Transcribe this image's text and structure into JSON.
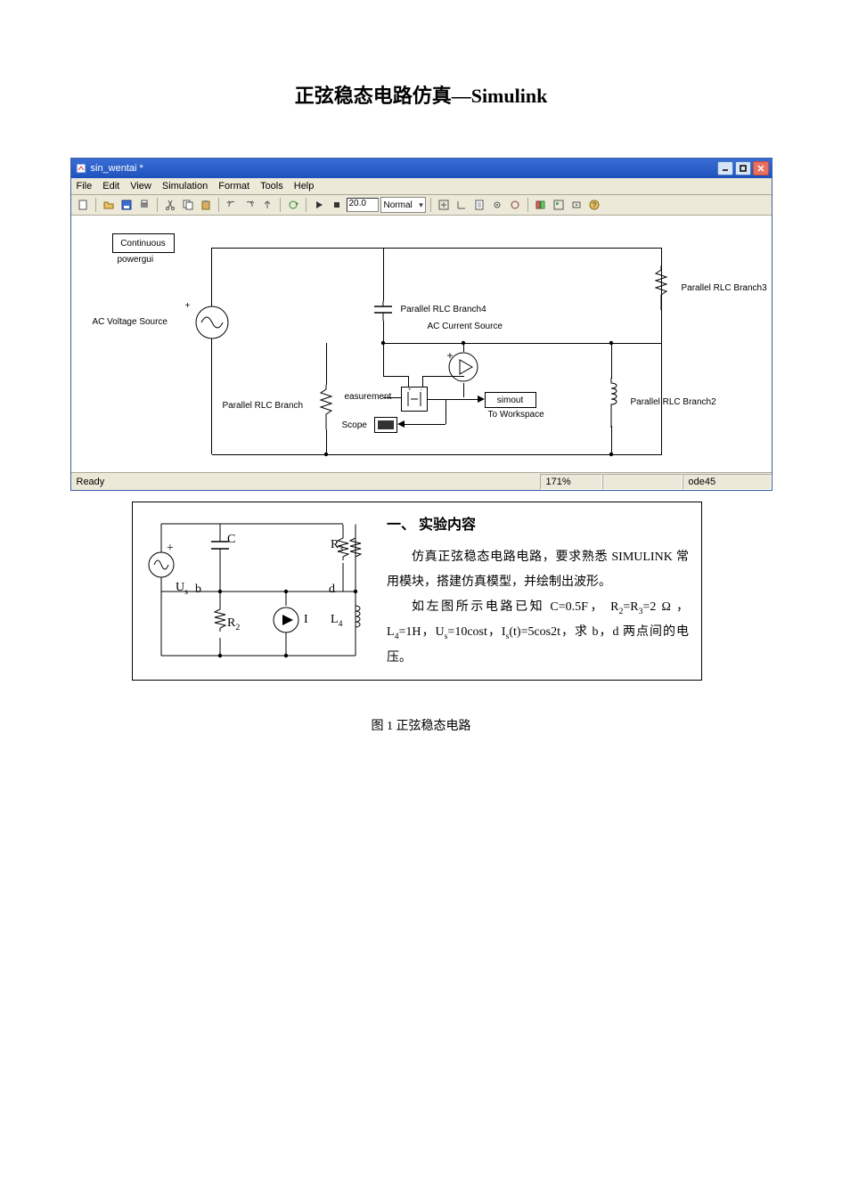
{
  "doc_title_cn": "正弦稳态电路仿真—",
  "doc_title_latin": "Simulink",
  "window": {
    "file_title": "sin_wentai *",
    "menu": [
      "File",
      "Edit",
      "View",
      "Simulation",
      "Format",
      "Tools",
      "Help"
    ],
    "toolbar": {
      "stop_time": "20.0",
      "mode": "Normal"
    },
    "status": {
      "ready": "Ready",
      "zoom": "171%",
      "solver": "ode45"
    }
  },
  "blocks": {
    "powergui_box": "Continuous",
    "powergui_label": "powergui",
    "ac_voltage": "AC Voltage Source",
    "branch": "Parallel RLC Branch",
    "branch2": "Parallel RLC Branch2",
    "branch3": "Parallel RLC Branch3",
    "branch4": "Parallel RLC Branch4",
    "ac_current": "AC Current Source",
    "measurement": "easurement",
    "scope": "Scope",
    "simout_box": "simout",
    "to_workspace": "To Workspace"
  },
  "schematic": {
    "Us": "Us",
    "plus": "+",
    "b": "b",
    "C": "C",
    "R2": "R2",
    "R3": "R3",
    "d": "d",
    "I": "I",
    "L4": "L4"
  },
  "section": {
    "title": "一、 实验内容",
    "p1": "仿真正弦稳态电路电路，要求熟悉 SIMULINK 常用模块，搭建仿真模型，并绘制出波形。",
    "p2a": "如左图所示电路已知 ",
    "p2b": "C=0.5F， R",
    "p2c": "=R",
    "p2d": "=2 Ω ， L",
    "p2e": "=1H，U",
    "p2f": "=10cost，I",
    "p2g": "(t)=5cos2t，求 b，d 两点间的电压。"
  },
  "caption": "图 1  正弦稳态电路"
}
